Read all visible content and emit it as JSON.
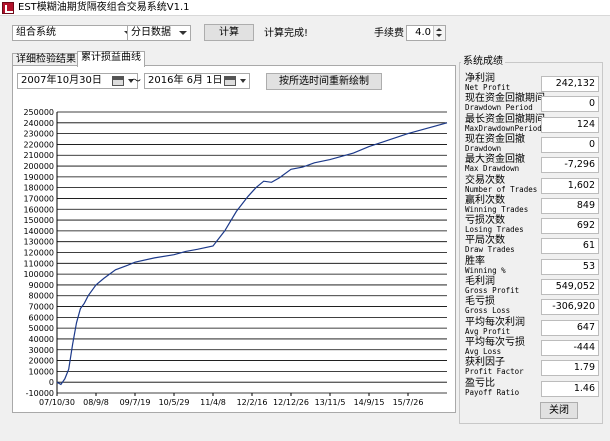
{
  "window": {
    "title": "EST模糊油期货隔夜组合交易系统V1.1"
  },
  "toolbar": {
    "system_select": "组合系统",
    "data_select": "分日数据",
    "calc_label": "计算",
    "status": "计算完成!",
    "fee_label": "手续费",
    "fee_value": "4.0"
  },
  "tabs": [
    {
      "label": "详细检验结果",
      "active": false
    },
    {
      "label": "累计损益曲线",
      "active": true
    }
  ],
  "date_range": {
    "start": "2007年10月30日",
    "separator": "～",
    "end": "2016年 6月 1日",
    "redraw_label": "按所选时间重新绘制"
  },
  "stats": {
    "title": "系统成绩",
    "items": [
      {
        "cn": "净利润",
        "en": "Net Profit",
        "value": "242,132"
      },
      {
        "cn": "现在资金回撤期间",
        "en": "Drawdown Period",
        "value": "0"
      },
      {
        "cn": "最长资金回撤期间",
        "en": "MaxDrawdownPeriod",
        "value": "124"
      },
      {
        "cn": "现在资金回撤",
        "en": "Drawdown",
        "value": "0"
      },
      {
        "cn": "最大资金回撤",
        "en": "Max Drawdown",
        "value": "-7,296"
      },
      {
        "cn": "交易次数",
        "en": "Number of Trades",
        "value": "1,602"
      },
      {
        "cn": "赢利次数",
        "en": "Winning Trades",
        "value": "849"
      },
      {
        "cn": "亏损次数",
        "en": "Losing Trades",
        "value": "692"
      },
      {
        "cn": "平局次数",
        "en": "Draw Trades",
        "value": "61"
      },
      {
        "cn": "胜率",
        "en": "Winning %",
        "value": "53"
      },
      {
        "cn": "毛利润",
        "en": "Gross Profit",
        "value": "549,052"
      },
      {
        "cn": "毛亏损",
        "en": "Gross Loss",
        "value": "-306,920"
      },
      {
        "cn": "平均每次利润",
        "en": "Avg Profit",
        "value": "647"
      },
      {
        "cn": "平均每次亏损",
        "en": "Avg Loss",
        "value": "-444"
      },
      {
        "cn": "获利因子",
        "en": "Profit Factor",
        "value": "1.79"
      },
      {
        "cn": "盈亏比",
        "en": "Payoff Ratio",
        "value": "1.46"
      }
    ],
    "close_label": "关闭"
  },
  "chart_data": {
    "type": "line",
    "x_tick_labels": [
      "07/10/30",
      "08/9/8",
      "09/7/19",
      "10/5/29",
      "11/4/8",
      "12/2/16",
      "12/12/26",
      "13/11/5",
      "14/9/15",
      "15/7/26"
    ],
    "ylim": [
      -10000,
      250000
    ],
    "y_ticks": [
      -10000,
      0,
      10000,
      20000,
      30000,
      40000,
      50000,
      60000,
      70000,
      80000,
      90000,
      100000,
      110000,
      120000,
      130000,
      140000,
      150000,
      160000,
      170000,
      180000,
      190000,
      200000,
      210000,
      220000,
      230000,
      240000,
      250000
    ],
    "grid": true,
    "x": [
      0,
      0.1,
      0.2,
      0.3,
      0.4,
      0.5,
      0.6,
      0.7,
      0.8,
      1.0,
      1.2,
      1.5,
      1.8,
      2.0,
      2.5,
      3.0,
      3.3,
      3.6,
      4.0,
      4.3,
      4.6,
      4.9,
      5.1,
      5.3,
      5.5,
      5.7,
      6.0,
      6.3,
      6.6,
      7.0,
      7.3,
      7.6,
      8.0,
      8.5,
      9.0,
      9.5,
      10.0
    ],
    "values": [
      0,
      -2000,
      3000,
      12000,
      35000,
      55000,
      68000,
      73000,
      80000,
      90000,
      96000,
      104000,
      108000,
      111000,
      115000,
      118000,
      121000,
      123000,
      126000,
      140000,
      158000,
      172000,
      180000,
      186000,
      185000,
      189000,
      197000,
      199000,
      203000,
      206000,
      209000,
      212000,
      218000,
      224000,
      230000,
      235000,
      240000
    ]
  }
}
